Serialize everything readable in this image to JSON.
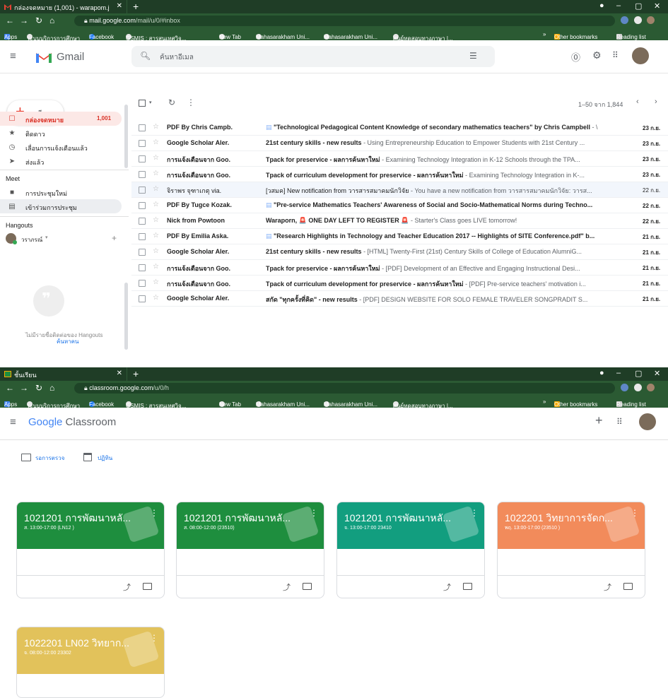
{
  "gmail": {
    "tab_title": "กล่องจดหมาย (1,001) - warapom.j",
    "url_host": "mail.google.com",
    "url_path": "/mail/u/0/#inbox",
    "brand": "Gmail",
    "search_placeholder": "ค้นหาอีเมล",
    "pagination": "1–50 จาก 1,844",
    "compose_label": "เขียน",
    "sidebar": [
      {
        "label": "กล่องจดหมาย",
        "count": "1,001",
        "icon": "inbox-icon"
      },
      {
        "label": "ติดดาว",
        "icon": "star-icon"
      },
      {
        "label": "เลื่อนการแจ้งเตือนแล้ว",
        "icon": "clock-icon"
      },
      {
        "label": "ส่งแล้ว",
        "icon": "send-icon"
      }
    ],
    "meet_heading": "Meet",
    "meet_items": [
      {
        "label": "การประชุมใหม่",
        "icon": "video-icon"
      },
      {
        "label": "เข้าร่วมการประชุม",
        "icon": "keyboard-icon"
      }
    ],
    "hangouts_heading": "Hangouts",
    "hangouts_user": "วราภรณ์",
    "hangouts_empty": "ไม่มีรายชื่อติดต่อของ Hangouts",
    "hangouts_find": "ค้นหาคน",
    "emails": [
      {
        "sender": "PDF By Chris Campb.",
        "subject": "\"Technological Pedagogical Content Knowledge of secondary mathematics teachers\" by Chris Campbell",
        "snippet": " - \\",
        "date": "23 ก.ย.",
        "read": false,
        "attach": true
      },
      {
        "sender": "Google Scholar Aler.",
        "subject": "21st century skills - new results",
        "snippet": " - Using Entrepreneurship Education to Empower Students with 21st Century ...",
        "date": "23 ก.ย.",
        "read": false,
        "attach": false
      },
      {
        "sender": "การแจ้งเตือนจาก Goo.",
        "subject": "Tpack for preservice - ผลการค้นหาใหม่",
        "snippet": " - Examining Technology Integration in K-12 Schools through the TPA...",
        "date": "23 ก.ย.",
        "read": false,
        "attach": false
      },
      {
        "sender": "การแจ้งเตือนจาก Goo.",
        "subject": "Tpack of curriculum development for preservice - ผลการค้นหาใหม่",
        "snippet": " - Examining Technology Integration in K-...",
        "date": "23 ก.ย.",
        "read": false,
        "attach": false
      },
      {
        "sender": "จิราพร จุฑาเกตุ via.",
        "subject": "[วสมค] New notification from วารสารสมาคมนักวิจัย",
        "snippet": " - You have a new notification from วารสารสมาคมนักวิจัย: วารส...",
        "date": "22 ก.ย.",
        "read": true,
        "attach": false
      },
      {
        "sender": "PDF By Tugce Kozak.",
        "subject": "\"Pre-service Mathematics Teachers' Awareness of Social and Socio-Mathematical Norms during Techno...",
        "snippet": "",
        "date": "22 ก.ย.",
        "read": false,
        "attach": true
      },
      {
        "sender": "Nick from Powtoon",
        "subject": "Waraporn, 🚨 ONE DAY LEFT TO REGISTER 🚨",
        "snippet": " - Starter's Class goes LIVE tomorrow!",
        "date": "22 ก.ย.",
        "read": false,
        "attach": false
      },
      {
        "sender": "PDF By Emilia Aska.",
        "subject": "\"Research Highlights in Technology and Teacher Education 2017 -- Highlights of SITE Conference.pdf\" b...",
        "snippet": "",
        "date": "21 ก.ย.",
        "read": false,
        "attach": true
      },
      {
        "sender": "Google Scholar Aler.",
        "subject": "21st century skills - new results",
        "snippet": " - [HTML] Twenty-First (21st) Century Skills of College of Education AlumniG...",
        "date": "21 ก.ย.",
        "read": false,
        "attach": false
      },
      {
        "sender": "การแจ้งเตือนจาก Goo.",
        "subject": "Tpack for preservice - ผลการค้นหาใหม่",
        "snippet": " - [PDF] Development of an Effective and Engaging Instructional Desi...",
        "date": "21 ก.ย.",
        "read": false,
        "attach": false
      },
      {
        "sender": "การแจ้งเตือนจาก Goo.",
        "subject": "Tpack of curriculum development for preservice - ผลการค้นหาใหม่",
        "snippet": " - [PDF] Pre-service teachers' motivation i...",
        "date": "21 ก.ย.",
        "read": false,
        "attach": false
      },
      {
        "sender": "Google Scholar Aler.",
        "subject": "สกัด \"ทุกครั้งที่คิด\" - new results",
        "snippet": " - [PDF] DESIGN WEBSITE FOR SOLO FEMALE TRAVELER SONGPRADIT S...",
        "date": "21 ก.ย.",
        "read": false,
        "attach": false
      }
    ]
  },
  "classroom": {
    "tab_title": "ชั้นเรียน",
    "url_host": "classroom.google.com",
    "url_path": "/u/0/h",
    "brand_google": "Google",
    "brand_product": "Classroom",
    "todo_label": "รอการตรวจ",
    "calendar_label": "ปฏิทิน",
    "cards": [
      {
        "title": "1021201 การพัฒนาหลั...",
        "subtitle": "ส. 13:00-17:00 (LN12 )",
        "color": "#1e8e3e"
      },
      {
        "title": "1021201 การพัฒนาหลั...",
        "subtitle": "ส. 08:00-12:00 (23510)",
        "color": "#1e8e3e"
      },
      {
        "title": "1021201 การพัฒนาหลั...",
        "subtitle": "จ. 13:00-17:00 23410",
        "color": "#129e7f"
      },
      {
        "title": "1022201 วิทยาการจัดก...",
        "subtitle": "พฤ. 13:00-17:00 (23510 )",
        "color": "#f28b5b"
      },
      {
        "title": "1022201 LN02 วิทยาก...",
        "subtitle": "จ. 08:00-12:00 23302",
        "color": "#e2c25b"
      }
    ]
  },
  "browser": {
    "bookmarks": [
      "Apps",
      "ระบบบริการการศึกษา",
      "Facebook",
      "GSMIS : สารสนเทศวิจ...",
      "New Tab",
      "Mahasarakham Uni...",
      "Mahasarakham Uni...",
      "ศูนย์ทดสอบทางภาษา |..."
    ],
    "other_bookmarks": "Other bookmarks",
    "reading_list": "Reading list"
  }
}
